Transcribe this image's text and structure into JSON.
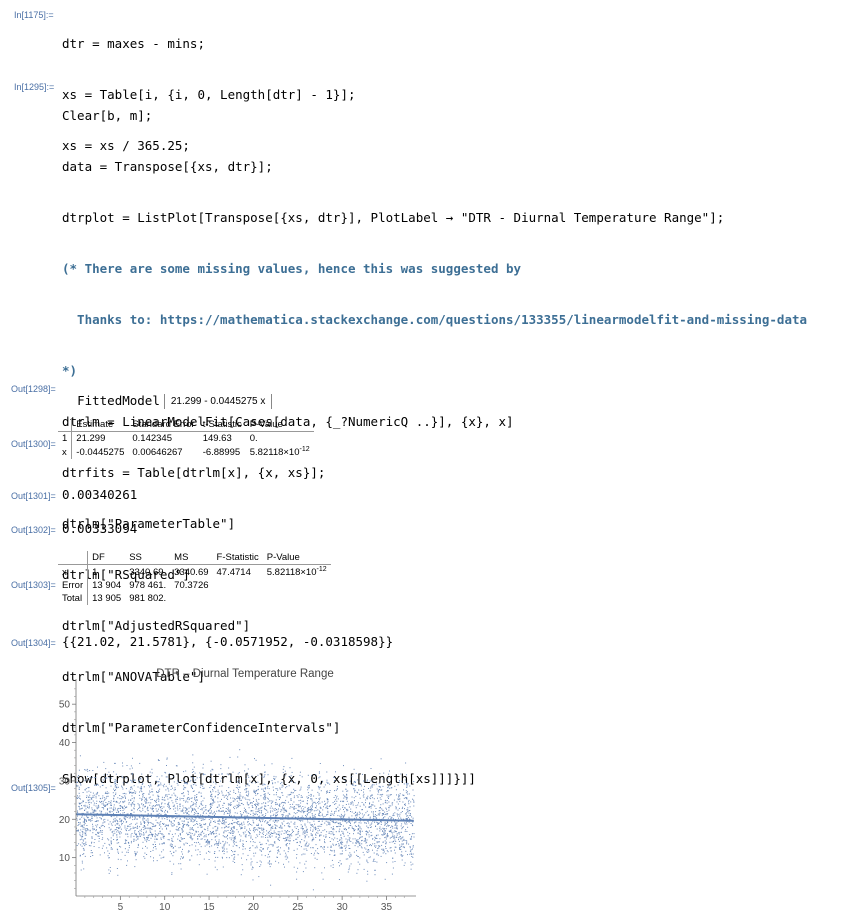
{
  "labels": {
    "in1175": "In[1175]:=",
    "in1295": "In[1295]:=",
    "out1298": "Out[1298]=",
    "out1300": "Out[1300]=",
    "out1301": "Out[1301]=",
    "out1302": "Out[1302]=",
    "out1303": "Out[1303]=",
    "out1304": "Out[1304]=",
    "out1305": "Out[1305]="
  },
  "input1": [
    "dtr = maxes - mins;",
    "xs = Table[i, {i, 0, Length[dtr] - 1}];",
    "xs = xs / 365.25;"
  ],
  "input2": [
    "Clear[b, m];",
    "data = Transpose[{xs, dtr}];",
    "dtrplot = ListPlot[Transpose[{xs, dtr}], PlotLabel → \"DTR - Diurnal Temperature Range\"];",
    "(* There are some missing values, hence this was suggested by",
    "  Thanks to: https://mathematica.stackexchange.com/questions/133355/linearmodelfit-and-missing-data",
    "*)",
    "dtrlm = LinearModelFit[Cases[data, {_?NumericQ ..}], {x}, x]",
    "dtrfits = Table[dtrlm[x], {x, xs}];",
    "dtrlm[\"ParameterTable\"]",
    "dtrlm[\"RSquared\"]",
    "dtrlm[\"AdjustedRSquared\"]",
    "dtrlm[\"ANOVATable\"]",
    "dtrlm[\"ParameterConfidenceIntervals\"]",
    "Show[dtrplot, Plot[dtrlm[x], {x, 0, xs[[Length[xs]]]}]]"
  ],
  "fitted_model": {
    "head": "FittedModel",
    "expr": "21.299 - 0.0445275 x"
  },
  "param_table": {
    "headers": [
      "",
      "Estimate",
      "Standard Error",
      "t-Statistic",
      "P-Value"
    ],
    "rows": [
      [
        "1",
        "21.299",
        "0.142345",
        "149.63",
        "0."
      ],
      [
        "x",
        "-0.0445275",
        "0.00646267",
        "-6.88995",
        "5.82118×10",
        "-12"
      ]
    ]
  },
  "rsquared": "0.00340261",
  "adj_rsquared": "0.00333094",
  "anova_table": {
    "headers": [
      "",
      "DF",
      "SS",
      "MS",
      "F-Statistic",
      "P-Value"
    ],
    "rows": [
      [
        "x",
        "1",
        "3340.69",
        "3340.69",
        "47.4714",
        "5.82118×10",
        "-12"
      ],
      [
        "Error",
        "13 904",
        "978 461.",
        "70.3726",
        "",
        "",
        ""
      ],
      [
        "Total",
        "13 905",
        "981 802.",
        "",
        "",
        "",
        ""
      ]
    ]
  },
  "conf_intervals": "{{21.02, 21.5781}, {-0.0571952, -0.0318598}}",
  "chart_data": {
    "type": "scatter",
    "title": "DTR – Diurnal Temperature Range",
    "xlabel": "",
    "ylabel": "",
    "xlim": [
      0,
      38.1
    ],
    "ylim": [
      0,
      55
    ],
    "x_ticks": [
      5,
      10,
      15,
      20,
      25,
      30,
      35
    ],
    "y_ticks": [
      10,
      20,
      30,
      40,
      50
    ],
    "fit_line": {
      "intercept": 21.299,
      "slope": -0.0445275,
      "x_range": [
        0,
        38.07
      ]
    },
    "series": [
      {
        "color": "#5e81b5"
      }
    ]
  },
  "colors": {
    "label": "#4a6fa5",
    "points": "#5e81b5",
    "comment": "#3d6f95"
  }
}
